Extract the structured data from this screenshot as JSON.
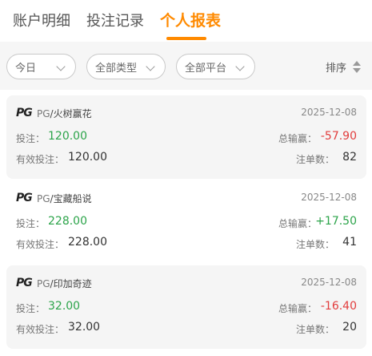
{
  "tabs": [
    {
      "label": "账户明细"
    },
    {
      "label": "投注记录"
    },
    {
      "label": "个人报表"
    }
  ],
  "active_tab_color": "#ff8a00",
  "filters": {
    "date": "今日",
    "type": "全部类型",
    "platform": "全部平台",
    "sort_label": "排序"
  },
  "labels": {
    "bet": "投注：",
    "valid_bet": "有效投注：",
    "win_loss": "总输赢：",
    "order_count": "注单数："
  },
  "colors": {
    "positive": "#2ca44a",
    "negative": "#e23d3d"
  },
  "records": [
    {
      "logo": "PG",
      "provider": "PG",
      "separator": "/",
      "game": "火树赢花",
      "date": "2025-12-08",
      "bet": "120.00",
      "valid_bet": "120.00",
      "win_loss": "-57.90",
      "orders": "82"
    },
    {
      "logo": "PG",
      "provider": "PG",
      "separator": "/",
      "game": "宝藏船说",
      "date": "2025-12-08",
      "bet": "228.00",
      "valid_bet": "228.00",
      "win_loss": "+17.50",
      "orders": "41"
    },
    {
      "logo": "PG",
      "provider": "PG",
      "separator": "/",
      "game": "印加奇迹",
      "date": "2025-12-08",
      "bet": "32.00",
      "valid_bet": "32.00",
      "win_loss": "-16.40",
      "orders": "20"
    }
  ]
}
